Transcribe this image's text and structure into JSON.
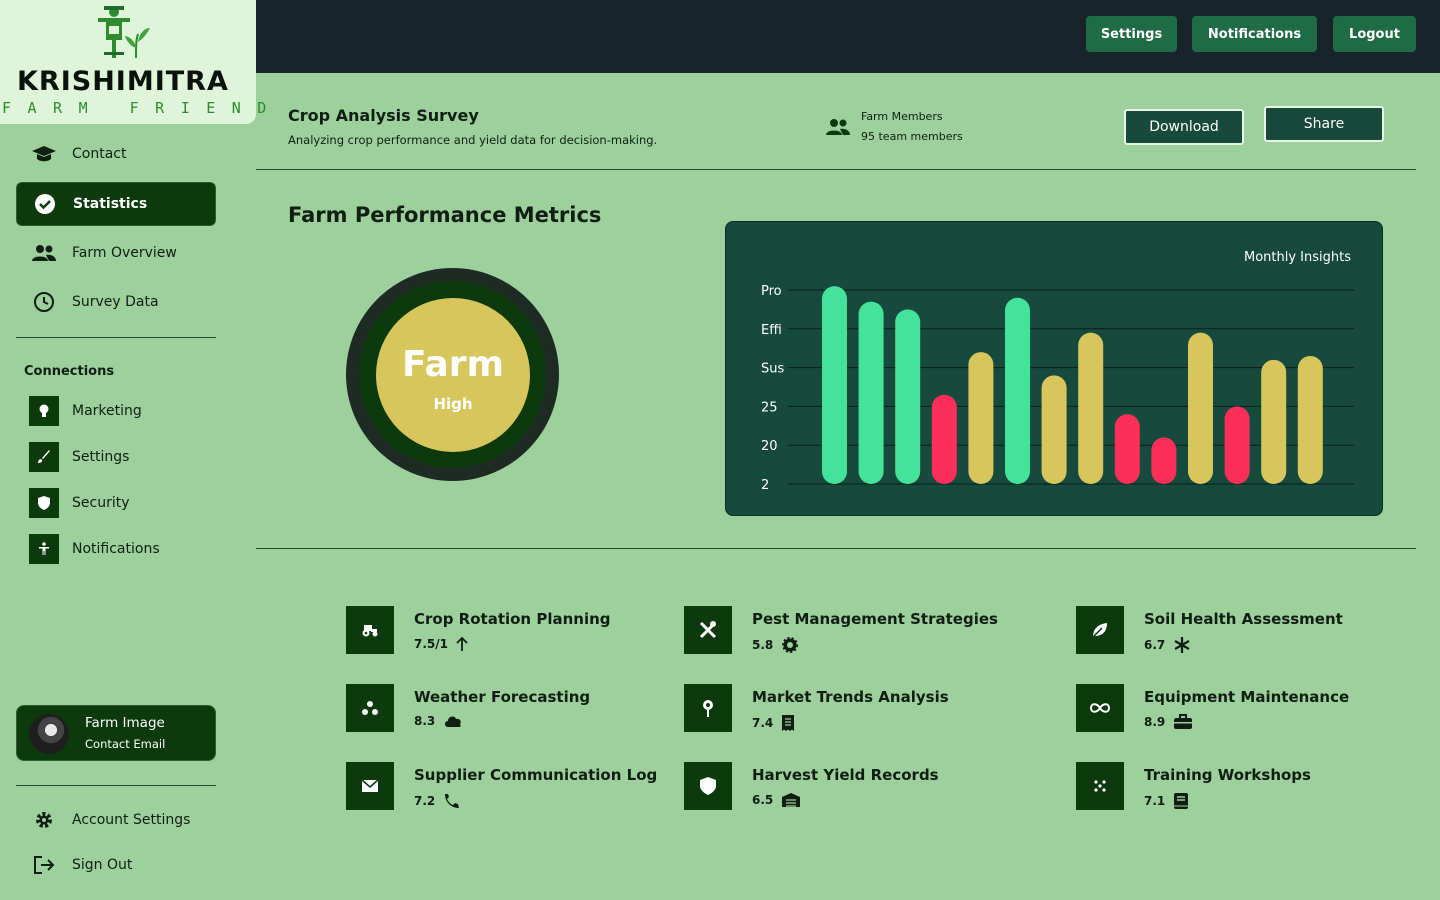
{
  "brand": {
    "name": "KRISHIMITRA",
    "tagline": "FARM FRIEND"
  },
  "topbar": {
    "buttons": [
      "Settings",
      "Notifications",
      "Logout"
    ]
  },
  "sidebar": {
    "items": [
      {
        "label": "Contact",
        "icon": "graduation-cap-icon",
        "active": false
      },
      {
        "label": "Statistics",
        "icon": "check-circle-icon",
        "active": true
      },
      {
        "label": "Farm Overview",
        "icon": "people-icon",
        "active": false
      },
      {
        "label": "Survey Data",
        "icon": "clock-icon",
        "active": false
      }
    ],
    "connections_title": "Connections",
    "connections": [
      {
        "label": "Marketing",
        "icon": "lightbulb-icon"
      },
      {
        "label": "Settings",
        "icon": "brush-icon"
      },
      {
        "label": "Security",
        "icon": "shield-icon"
      },
      {
        "label": "Notifications",
        "icon": "accessibility-icon"
      }
    ],
    "profile": {
      "name": "Farm Image",
      "email": "Contact Email"
    },
    "bottom": [
      {
        "label": "Account Settings",
        "icon": "gear-icon"
      },
      {
        "label": "Sign Out",
        "icon": "logout-icon"
      }
    ]
  },
  "survey": {
    "title": "Crop Analysis Survey",
    "subtitle": "Analyzing crop performance and yield data for decision-making.",
    "members_label": "Farm Members",
    "members_count": "95 team members",
    "download": "Download",
    "share": "Share"
  },
  "metrics": {
    "title": "Farm Performance Metrics",
    "gauge": {
      "label": "Farm",
      "level": "High"
    }
  },
  "chart_data": {
    "type": "bar",
    "title": "Monthly Insights",
    "y_tick_labels": [
      "Pro",
      "Effi",
      "Sus",
      "25",
      "20",
      "2"
    ],
    "values": [
      5.1,
      4.7,
      4.5,
      2.3,
      3.4,
      4.8,
      2.8,
      3.9,
      1.8,
      1.2,
      3.9,
      2.0,
      3.2,
      3.3
    ],
    "bar_colors": [
      "#44e39a",
      "#44e39a",
      "#44e39a",
      "#fb2f57",
      "#d6c65c",
      "#44e39a",
      "#d6c65c",
      "#d6c65c",
      "#fb2f57",
      "#fb2f57",
      "#d6c65c",
      "#fb2f57",
      "#d6c65c",
      "#d6c65c"
    ],
    "ylim": [
      0,
      5
    ],
    "grid": true
  },
  "features": [
    {
      "title": "Crop Rotation Planning",
      "value": "7.5/1",
      "icon": "tractor-icon",
      "trend_icon": "arrow-up-icon"
    },
    {
      "title": "Pest Management Strategies",
      "value": "5.8",
      "icon": "tools-icon",
      "trend_icon": "sun-icon"
    },
    {
      "title": "Soil Health Assessment",
      "value": "6.7",
      "icon": "leaf-icon",
      "trend_icon": "snowflake-icon"
    },
    {
      "title": "Weather Forecasting",
      "value": "8.3",
      "icon": "dots-icon",
      "trend_icon": "cloud-icon"
    },
    {
      "title": "Market Trends Analysis",
      "value": "7.4",
      "icon": "pin-icon",
      "trend_icon": "receipt-icon"
    },
    {
      "title": "Equipment Maintenance",
      "value": "8.9",
      "icon": "infinity-icon",
      "trend_icon": "toolbox-icon"
    },
    {
      "title": "Supplier Communication Log",
      "value": "7.2",
      "icon": "envelope-icon",
      "trend_icon": "phone-icon"
    },
    {
      "title": "Harvest Yield Records",
      "value": "6.5",
      "icon": "shield-icon",
      "trend_icon": "warehouse-icon"
    },
    {
      "title": "Training Workshops",
      "value": "7.1",
      "icon": "grid-dots-icon",
      "trend_icon": "book-icon"
    }
  ]
}
